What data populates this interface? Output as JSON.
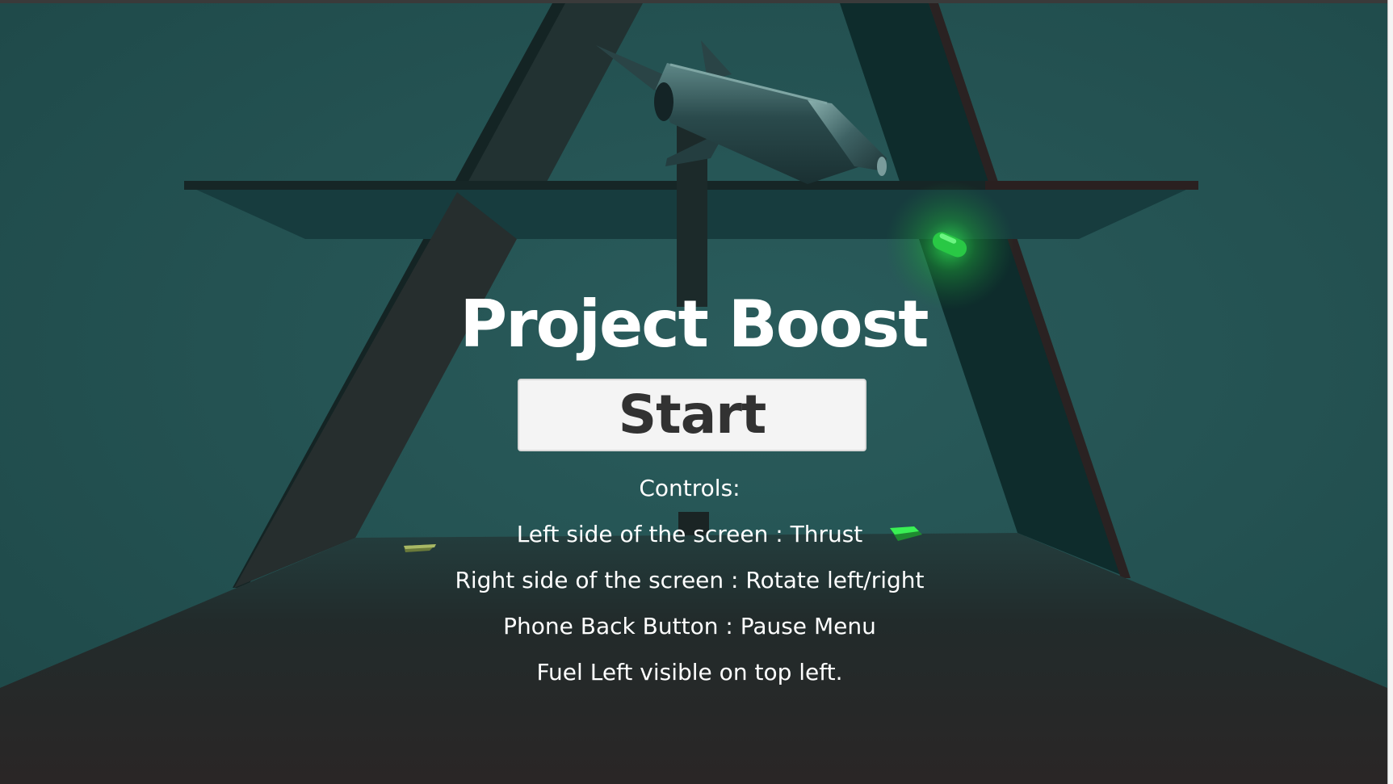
{
  "game": {
    "title": "Project Boost",
    "start_button_label": "Start",
    "controls_heading": "Controls:",
    "controls": [
      "Left side of the screen : Thrust",
      "Right side of the screen : Rotate left/right",
      "Phone Back Button : Pause Menu",
      "Fuel Left visible on top left."
    ]
  },
  "colors": {
    "background": "#235050",
    "floor": "#2a2a2a",
    "title_text": "#ffffff",
    "button_bg": "#f4f4f4",
    "button_text": "#323232",
    "glow": "#28e84a"
  },
  "icons": {
    "rocket": "rocket-ship",
    "fuel_pickup": "glowing-green-capsule",
    "landing_pad": "green-landing-pad",
    "launch_pad": "yellow-launch-pad"
  }
}
